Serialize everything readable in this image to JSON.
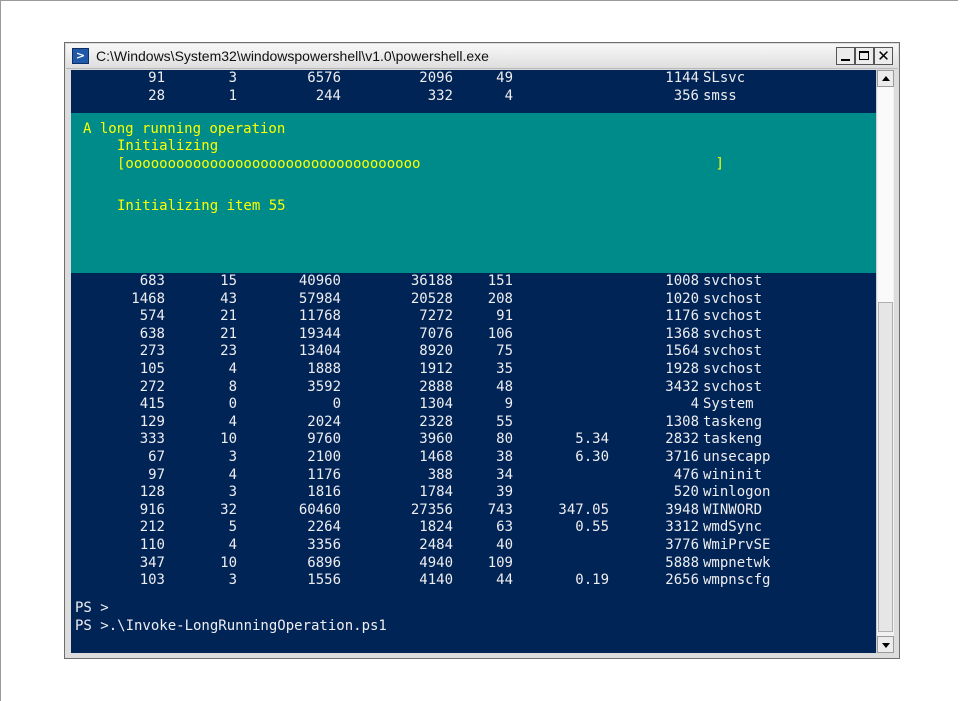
{
  "window": {
    "title": "C:\\Windows\\System32\\windowspowershell\\v1.0\\powershell.exe",
    "icon": "powershell-icon",
    "controls": {
      "minimize": "minimize-icon",
      "maximize": "maximize-icon",
      "close": "close-icon"
    }
  },
  "colors": {
    "console_bg": "#012456",
    "console_fg": "#eeedf0",
    "progress_bg": "#008b8b",
    "progress_fg": "#ffff00"
  },
  "top_rows": [
    [
      "91",
      "3",
      "6576",
      "2096",
      "49",
      "",
      "1144",
      "SLsvc"
    ],
    [
      "28",
      "1",
      "244",
      "332",
      "4",
      "",
      "356",
      "smss"
    ]
  ],
  "progress": {
    "activity": "A long running operation",
    "status": "Initializing",
    "bar": "[ooooooooooooooooooooooooooooooooooo                                   ]",
    "current_operation": "Initializing item 55"
  },
  "rows": [
    [
      "683",
      "15",
      "40960",
      "36188",
      "151",
      "",
      "1008",
      "svchost"
    ],
    [
      "1468",
      "43",
      "57984",
      "20528",
      "208",
      "",
      "1020",
      "svchost"
    ],
    [
      "574",
      "21",
      "11768",
      "7272",
      "91",
      "",
      "1176",
      "svchost"
    ],
    [
      "638",
      "21",
      "19344",
      "7076",
      "106",
      "",
      "1368",
      "svchost"
    ],
    [
      "273",
      "23",
      "13404",
      "8920",
      "75",
      "",
      "1564",
      "svchost"
    ],
    [
      "105",
      "4",
      "1888",
      "1912",
      "35",
      "",
      "1928",
      "svchost"
    ],
    [
      "272",
      "8",
      "3592",
      "2888",
      "48",
      "",
      "3432",
      "svchost"
    ],
    [
      "415",
      "0",
      "0",
      "1304",
      "9",
      "",
      "4",
      "System"
    ],
    [
      "129",
      "4",
      "2024",
      "2328",
      "55",
      "",
      "1308",
      "taskeng"
    ],
    [
      "333",
      "10",
      "9760",
      "3960",
      "80",
      "5.34",
      "2832",
      "taskeng"
    ],
    [
      "67",
      "3",
      "2100",
      "1468",
      "38",
      "6.30",
      "3716",
      "unsecapp"
    ],
    [
      "97",
      "4",
      "1176",
      "388",
      "34",
      "",
      "476",
      "wininit"
    ],
    [
      "128",
      "3",
      "1816",
      "1784",
      "39",
      "",
      "520",
      "winlogon"
    ],
    [
      "916",
      "32",
      "60460",
      "27356",
      "743",
      "347.05",
      "3948",
      "WINWORD"
    ],
    [
      "212",
      "5",
      "2264",
      "1824",
      "63",
      "0.55",
      "3312",
      "wmdSync"
    ],
    [
      "110",
      "4",
      "3356",
      "2484",
      "40",
      "",
      "3776",
      "WmiPrvSE"
    ],
    [
      "347",
      "10",
      "6896",
      "4940",
      "109",
      "",
      "5888",
      "wmpnetwk"
    ],
    [
      "103",
      "3",
      "1556",
      "4140",
      "44",
      "0.19",
      "2656",
      "wmpnscfg"
    ]
  ],
  "prompt": {
    "line1": "PS >",
    "line2": "PS >.\\Invoke-LongRunningOperation.ps1"
  }
}
